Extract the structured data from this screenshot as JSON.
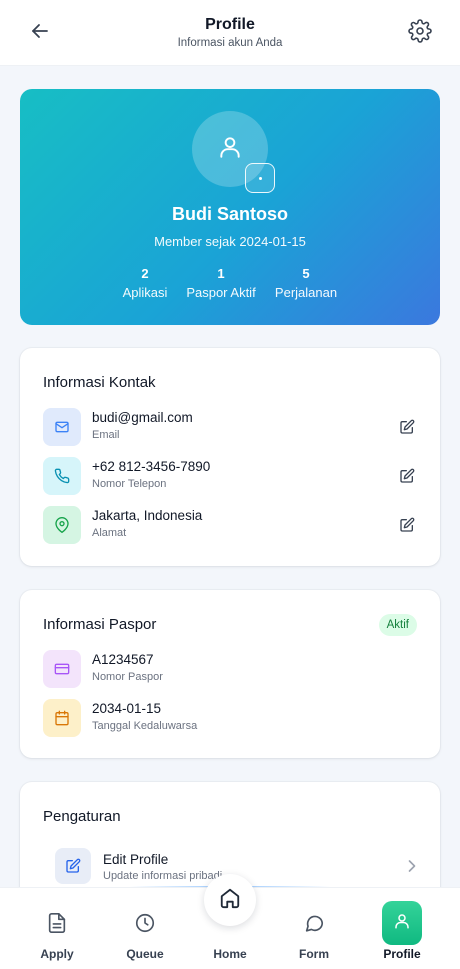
{
  "header": {
    "title": "Profile",
    "subtitle": "Informasi akun Anda"
  },
  "profile": {
    "name": "Budi Santoso",
    "member_since": "Member sejak 2024-01-15",
    "stats": [
      {
        "value": "2",
        "label": "Aplikasi"
      },
      {
        "value": "1",
        "label": "Paspor Aktif"
      },
      {
        "value": "5",
        "label": "Perjalanan"
      }
    ]
  },
  "contact": {
    "title": "Informasi Kontak",
    "items": [
      {
        "value": "budi@gmail.com",
        "label": "Email",
        "icon": "mail-icon"
      },
      {
        "value": "+62 812-3456-7890",
        "label": "Nomor Telepon",
        "icon": "phone-icon"
      },
      {
        "value": "Jakarta, Indonesia",
        "label": "Alamat",
        "icon": "map-pin-icon"
      }
    ]
  },
  "passport": {
    "title": "Informasi Paspor",
    "status": "Aktif",
    "items": [
      {
        "value": "A1234567",
        "label": "Nomor Paspor",
        "icon": "card-icon"
      },
      {
        "value": "2034-01-15",
        "label": "Tanggal Kedaluwarsa",
        "icon": "calendar-icon"
      }
    ]
  },
  "settings": {
    "title": "Pengaturan",
    "items": [
      {
        "label": "Edit Profile",
        "description": "Update informasi pribadi",
        "icon": "edit-icon"
      }
    ]
  },
  "bottom_nav": {
    "items": [
      {
        "label": "Apply",
        "icon": "document-icon"
      },
      {
        "label": "Queue",
        "icon": "clock-icon"
      },
      {
        "label": "Home",
        "icon": "home-icon"
      },
      {
        "label": "Form",
        "icon": "chat-icon"
      },
      {
        "label": "Profile",
        "icon": "user-icon"
      }
    ],
    "active": "Profile"
  },
  "colors": {
    "hero_gradient_start": "#17bec4",
    "hero_gradient_end": "#3b78de",
    "accent_green": "#10b981",
    "badge_bg": "#dcfce7",
    "badge_text": "#15803d"
  }
}
